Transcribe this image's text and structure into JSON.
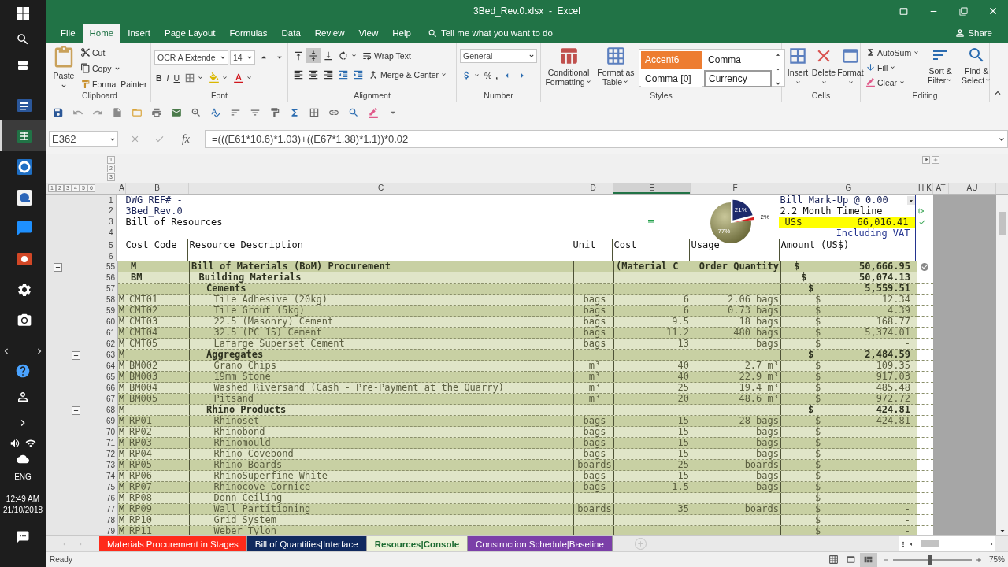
{
  "taskbar": {
    "pinned_apps": [
      {
        "selected": false
      },
      {
        "selected": true
      },
      {
        "selected": false
      },
      {
        "selected": false
      },
      {
        "selected": false
      },
      {
        "selected": false
      },
      {
        "selected": false
      },
      {
        "selected": false
      }
    ],
    "language": "ENG",
    "time": "12:49 AM",
    "date": "21/10/2018"
  },
  "window": {
    "title": "3Bed_Rev.0.xlsx  -  Excel"
  },
  "ribbon_tabs": [
    {
      "label": "File",
      "selected": false
    },
    {
      "label": "Home",
      "selected": true
    },
    {
      "label": "Insert",
      "selected": false
    },
    {
      "label": "Page Layout",
      "selected": false
    },
    {
      "label": "Formulas",
      "selected": false
    },
    {
      "label": "Data",
      "selected": false
    },
    {
      "label": "Review",
      "selected": false
    },
    {
      "label": "View",
      "selected": false
    },
    {
      "label": "Help",
      "selected": false
    }
  ],
  "tell_me": "Tell me what you want to do",
  "share": "Share",
  "ribbon": {
    "clipboard": {
      "label": "Clipboard",
      "paste": "Paste",
      "cut": "Cut",
      "copy": "Copy",
      "format_painter": "Format Painter"
    },
    "font": {
      "label": "Font",
      "font_name": "OCR A Extende",
      "font_size": "14",
      "bold": "B",
      "italic": "I",
      "underline": "U"
    },
    "alignment": {
      "label": "Alignment",
      "wrap_text": "Wrap Text",
      "merge_center": "Merge & Center"
    },
    "number": {
      "label": "Number",
      "format": "General",
      "percent": "%",
      "comma": ","
    },
    "styles": {
      "label": "Styles",
      "conditional_formatting": "Conditional Formatting",
      "format_as_table": "Format as Table",
      "gallery": [
        {
          "label": "Accent6",
          "kind": "accent",
          "selected": false
        },
        {
          "label": "Comma",
          "kind": "plain",
          "selected": false
        },
        {
          "label": "Comma [0]",
          "kind": "plain",
          "selected": false
        },
        {
          "label": "Currency",
          "kind": "plain",
          "selected": true
        }
      ]
    },
    "cells": {
      "label": "Cells",
      "insert": "Insert",
      "delete": "Delete",
      "format": "Format"
    },
    "editing": {
      "label": "Editing",
      "autosum": "AutoSum",
      "fill": "Fill",
      "clear": "Clear",
      "sort_filter": "Sort & Filter",
      "find_select": "Find & Select"
    }
  },
  "formula_bar": {
    "name_box": "E362",
    "function_label": "fx",
    "formula": "=(((E61*10.6)*1.03)+((E67*1.38)*1.1))*0.02"
  },
  "sheet": {
    "column_levels": [
      "1",
      "2",
      "3"
    ],
    "row_levels": [
      "1",
      "2",
      "3",
      "4",
      "5",
      "6"
    ],
    "columns": [
      {
        "label": "A",
        "selected": false
      },
      {
        "label": "B",
        "selected": false
      },
      {
        "label": "C",
        "selected": false
      },
      {
        "label": "D",
        "selected": false
      },
      {
        "label": "E",
        "selected": true
      },
      {
        "label": "F",
        "selected": false
      },
      {
        "label": "G",
        "selected": false
      },
      {
        "label": "H",
        "selected": false
      },
      {
        "label": "K",
        "selected": false
      },
      {
        "label": "AT",
        "selected": false
      },
      {
        "label": "AU",
        "selected": false
      }
    ],
    "header": {
      "row_numbers": [
        "1",
        "2",
        "3",
        "4",
        "5",
        "6"
      ],
      "dwg_ref": "DWG REF# -",
      "revision": "3Bed_Rev.0",
      "title": "Bill of Resources",
      "markup": "Bill Mark-Up @ 0.00",
      "timeline": "2.2 Month Timeline",
      "total_currency": "US$",
      "total": "66,016.41",
      "vat_note": "Including VAT",
      "column_titles": [
        "Cost Code",
        "Resource Description",
        "Unit",
        "Cost",
        "Usage",
        "Amount (US$)"
      ]
    },
    "chart_data": {
      "type": "pie",
      "values": [
        77,
        21,
        2
      ],
      "value_labels": [
        "77%",
        "21%",
        "2%"
      ]
    },
    "rows": [
      {
        "row": "55",
        "code": "M",
        "description": "Bill of Materials (BoM) Procurement",
        "cost": "(Material C",
        "usage": "Order Quantity",
        "currency": "$",
        "amount": "50,666.95",
        "expanded": true,
        "children": [
          {
            "row": "56",
            "code": "BM",
            "description": "Building Materials",
            "currency": "$",
            "amount": "50,074.13",
            "children": [
              {
                "row": "57",
                "description": "Cements",
                "currency": "$",
                "amount": "5,559.51",
                "children": [
                  {
                    "row": "58",
                    "mark": "M",
                    "code": "CMT01",
                    "description": "Tile Adhesive (20kg)",
                    "unit": "bags",
                    "cost": "6",
                    "usage": "2.06 bags",
                    "currency": "$",
                    "amount": "12.34"
                  },
                  {
                    "row": "59",
                    "mark": "M",
                    "code": "CMT02",
                    "description": "Tile Grout (5kg)",
                    "unit": "bags",
                    "cost": "6",
                    "usage": "0.73 bags",
                    "currency": "$",
                    "amount": "4.39"
                  },
                  {
                    "row": "60",
                    "mark": "M",
                    "code": "CMT03",
                    "description": "22.5 (Masonry) Cement",
                    "unit": "bags",
                    "cost": "9.5",
                    "usage": "18 bags",
                    "currency": "$",
                    "amount": "168.77"
                  },
                  {
                    "row": "61",
                    "mark": "M",
                    "code": "CMT04",
                    "description": "32.5 (PC 15) Cement",
                    "unit": "bags",
                    "cost": "11.2",
                    "usage": "480 bags",
                    "currency": "$",
                    "amount": "5,374.01"
                  },
                  {
                    "row": "62",
                    "mark": "M",
                    "code": "CMT05",
                    "description": "Lafarge Superset Cement",
                    "unit": "bags",
                    "cost": "13",
                    "usage": "bags",
                    "currency": "$",
                    "amount": "-"
                  }
                ]
              },
              {
                "row": "63",
                "mark": "M",
                "description": "Aggregates",
                "currency": "$",
                "amount": "2,484.59",
                "expanded": true,
                "children": [
                  {
                    "row": "64",
                    "mark": "M",
                    "code": "BM002",
                    "description": "Grano Chips",
                    "unit": "m³",
                    "cost": "40",
                    "usage": "2.7 m³",
                    "currency": "$",
                    "amount": "109.35"
                  },
                  {
                    "row": "65",
                    "mark": "M",
                    "code": "BM003",
                    "description": "19mm Stone",
                    "unit": "m³",
                    "cost": "40",
                    "usage": "22.9 m³",
                    "currency": "$",
                    "amount": "917.03"
                  },
                  {
                    "row": "66",
                    "mark": "M",
                    "code": "BM004",
                    "description": "Washed Riversand (Cash - Pre-Payment at the Quarry)",
                    "unit": "m³",
                    "cost": "25",
                    "usage": "19.4 m³",
                    "currency": "$",
                    "amount": "485.48"
                  },
                  {
                    "row": "67",
                    "mark": "M",
                    "code": "BM005",
                    "description": "Pitsand",
                    "unit": "m³",
                    "cost": "20",
                    "usage": "48.6 m³",
                    "currency": "$",
                    "amount": "972.72"
                  }
                ]
              },
              {
                "row": "68",
                "mark": "M",
                "description": "Rhino Products",
                "currency": "$",
                "amount": "424.81",
                "expanded": true,
                "children": [
                  {
                    "row": "69",
                    "mark": "M",
                    "code": "RP01",
                    "description": "Rhinoset",
                    "unit": "bags",
                    "cost": "15",
                    "usage": "28 bags",
                    "currency": "$",
                    "amount": "424.81"
                  },
                  {
                    "row": "70",
                    "mark": "M",
                    "code": "RP02",
                    "description": "Rhinobond",
                    "unit": "bags",
                    "cost": "15",
                    "usage": "bags",
                    "currency": "$",
                    "amount": "-"
                  },
                  {
                    "row": "71",
                    "mark": "M",
                    "code": "RP03",
                    "description": "Rhinomould",
                    "unit": "bags",
                    "cost": "15",
                    "usage": "bags",
                    "currency": "$",
                    "amount": "-"
                  },
                  {
                    "row": "72",
                    "mark": "M",
                    "code": "RP04",
                    "description": "Rhino Covebond",
                    "unit": "bags",
                    "cost": "15",
                    "usage": "bags",
                    "currency": "$",
                    "amount": "-"
                  },
                  {
                    "row": "73",
                    "mark": "M",
                    "code": "RP05",
                    "description": "Rhino Boards",
                    "unit": "boards",
                    "cost": "25",
                    "usage": "boards",
                    "currency": "$",
                    "amount": "-"
                  },
                  {
                    "row": "74",
                    "mark": "M",
                    "code": "RP06",
                    "description": "RhinoSuperfine White",
                    "unit": "bags",
                    "cost": "15",
                    "usage": "bags",
                    "currency": "$",
                    "amount": "-"
                  },
                  {
                    "row": "75",
                    "mark": "M",
                    "code": "RP07",
                    "description": "Rhinocove Cornice",
                    "unit": "bags",
                    "cost": "1.5",
                    "usage": "bags",
                    "currency": "$",
                    "amount": "-"
                  },
                  {
                    "row": "76",
                    "mark": "M",
                    "code": "RP08",
                    "description": "Donn Ceiling",
                    "currency": "$",
                    "amount": "-"
                  },
                  {
                    "row": "77",
                    "mark": "M",
                    "code": "RP09",
                    "description": "Wall Partitioning",
                    "unit": "boards",
                    "cost": "35",
                    "usage": "boards",
                    "currency": "$",
                    "amount": "-"
                  },
                  {
                    "row": "78",
                    "mark": "M",
                    "code": "RP10",
                    "description": "Grid System",
                    "currency": "$",
                    "amount": "-"
                  },
                  {
                    "row": "79",
                    "mark": "M",
                    "code": "RP11",
                    "description": "Weber Tylon",
                    "currency": "$",
                    "amount": "-"
                  }
                ]
              }
            ]
          }
        ]
      }
    ]
  },
  "sheet_tabs": [
    {
      "label": "Materials Procurement in Stages",
      "color": "#ff2a1a",
      "selected": false
    },
    {
      "label": "Bill of Quantities|Interface",
      "color": "#10295e",
      "selected": false
    },
    {
      "label": "Resources|Console",
      "color": "#edf2d8",
      "selected": true
    },
    {
      "label": "Construction Schedule|Baseline",
      "color": "#7b3fa8",
      "selected": false
    }
  ],
  "status_bar": {
    "status": "Ready",
    "views": [
      {
        "selected": false
      },
      {
        "selected": false
      },
      {
        "selected": true
      }
    ],
    "zoom": {
      "level": 0.47,
      "reading": "75%"
    }
  }
}
